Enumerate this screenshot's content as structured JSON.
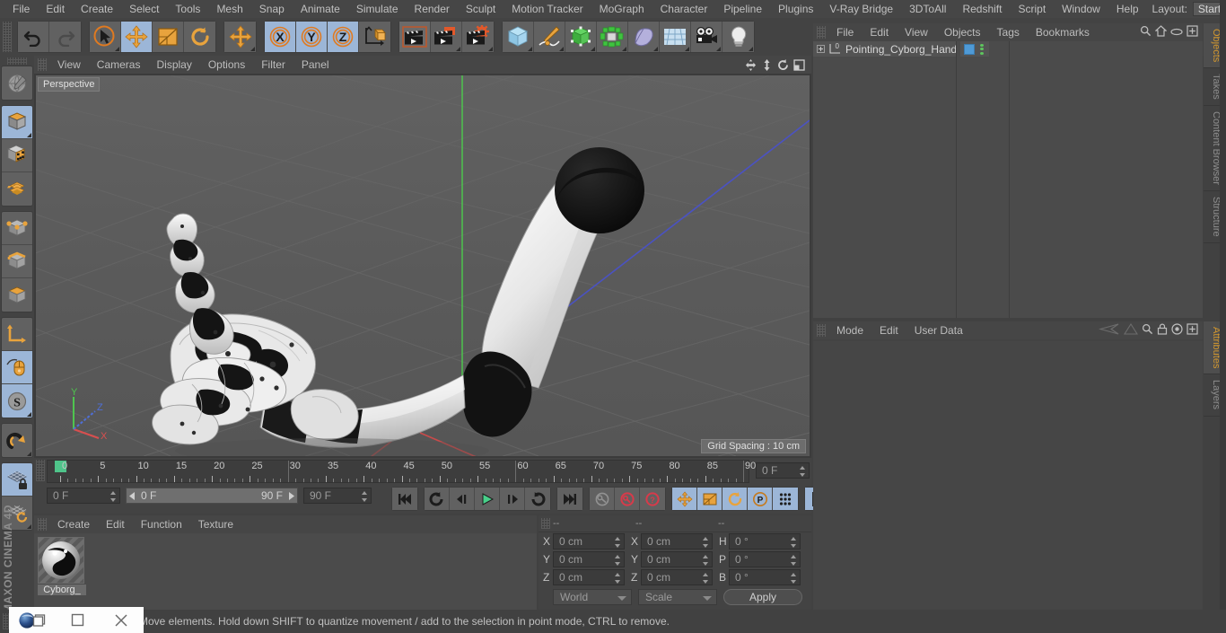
{
  "app": {
    "title": "CINEMA 4D",
    "brand": "MAXON CINEMA 4D"
  },
  "menubar": {
    "items": [
      "File",
      "Edit",
      "Create",
      "Select",
      "Tools",
      "Mesh",
      "Snap",
      "Animate",
      "Simulate",
      "Render",
      "Sculpt",
      "Motion Tracker",
      "MoGraph",
      "Character",
      "Pipeline",
      "Plugins",
      "V-Ray Bridge",
      "3DToAll",
      "Redshift",
      "Script",
      "Window",
      "Help"
    ],
    "layout_label": "Layout:",
    "layout_value": "Startup",
    "search_icon": "magnifier-icon"
  },
  "toolbar": {
    "groups": [
      {
        "name": "history",
        "buttons": [
          {
            "name": "undo-button",
            "icon": "undo-icon",
            "active": false
          },
          {
            "name": "redo-button",
            "icon": "redo-icon",
            "active": false,
            "disabled": true
          }
        ]
      },
      {
        "name": "tools",
        "buttons": [
          {
            "name": "live-selection-button",
            "icon": "live-selection-icon",
            "active": false
          },
          {
            "name": "move-button",
            "icon": "move-icon",
            "active": true
          },
          {
            "name": "scale-button",
            "icon": "scale-icon",
            "active": false
          },
          {
            "name": "rotate-button",
            "icon": "rotate-icon",
            "active": false
          }
        ]
      },
      {
        "name": "move-single",
        "buttons": [
          {
            "name": "move-tool-button",
            "icon": "move-icon",
            "active": false
          }
        ]
      },
      {
        "name": "axis-locks",
        "buttons": [
          {
            "name": "lock-x-button",
            "icon": "x-axis-icon",
            "active": true
          },
          {
            "name": "lock-y-button",
            "icon": "y-axis-icon",
            "active": true
          },
          {
            "name": "lock-z-button",
            "icon": "z-axis-icon",
            "active": true
          },
          {
            "name": "world-object-coordinate-button",
            "icon": "world-coordinate-icon",
            "active": false
          }
        ]
      },
      {
        "name": "render",
        "buttons": [
          {
            "name": "render-view-button",
            "icon": "render-view-icon",
            "active": false
          },
          {
            "name": "render-to-picture-viewer-button",
            "icon": "render-picture-viewer-icon",
            "active": false
          },
          {
            "name": "render-settings-button",
            "icon": "render-settings-icon",
            "active": false
          }
        ]
      },
      {
        "name": "objects",
        "buttons": [
          {
            "name": "add-cube-button",
            "icon": "cube-icon",
            "active": false
          },
          {
            "name": "add-spline-button",
            "icon": "pen-spline-icon",
            "active": false
          },
          {
            "name": "add-generator-button",
            "icon": "generator-icon",
            "active": false
          },
          {
            "name": "add-mograph-button",
            "icon": "mograph-icon",
            "active": false
          },
          {
            "name": "add-deformer-button",
            "icon": "deformer-icon",
            "active": false
          },
          {
            "name": "add-floor-button",
            "icon": "environment-icon",
            "active": false
          },
          {
            "name": "add-camera-button",
            "icon": "camera-icon",
            "active": false
          },
          {
            "name": "add-light-button",
            "icon": "light-bulb-icon",
            "active": false
          }
        ]
      }
    ]
  },
  "left_toolbar": {
    "groups": [
      {
        "buttons": [
          {
            "name": "make-editable-button",
            "icon": "make-editable-icon",
            "active": false
          }
        ]
      },
      {
        "buttons": [
          {
            "name": "model-mode-button",
            "icon": "model-mode-icon",
            "active": true
          },
          {
            "name": "texture-mode-button",
            "icon": "texture-mode-icon",
            "active": false
          },
          {
            "name": "workplane-mode-button",
            "icon": "workplane-icon",
            "active": false
          }
        ]
      },
      {
        "buttons": [
          {
            "name": "points-mode-button",
            "icon": "points-mode-icon",
            "active": false
          },
          {
            "name": "edges-mode-button",
            "icon": "edges-mode-icon",
            "active": false
          },
          {
            "name": "polygons-mode-button",
            "icon": "polygons-mode-icon",
            "active": false
          }
        ]
      },
      {
        "buttons": [
          {
            "name": "axis-mode-button",
            "icon": "axis-mode-icon",
            "active": false
          },
          {
            "name": "enable-axis-button",
            "icon": "mouse-axis-icon",
            "active": true
          },
          {
            "name": "soft-selection-button",
            "icon": "soft-selection-icon",
            "active": true
          }
        ]
      },
      {
        "buttons": [
          {
            "name": "snap-button",
            "icon": "magnet-snap-icon",
            "active": false
          }
        ]
      },
      {
        "buttons": [
          {
            "name": "workplane-lock-button",
            "icon": "workplane-lock-icon",
            "active": true
          },
          {
            "name": "planar-workplane-button",
            "icon": "planar-workplane-icon",
            "active": false
          }
        ]
      }
    ]
  },
  "viewport": {
    "menu_items": [
      "View",
      "Cameras",
      "Display",
      "Options",
      "Filter",
      "Panel"
    ],
    "view_label": "Perspective",
    "grid_info": "Grid Spacing : 10 cm",
    "nav_icons": [
      "pan-view-icon",
      "dolly-view-icon",
      "rotate-view-icon",
      "maximize-view-icon"
    ],
    "axis_labels": {
      "x": "X",
      "y": "Y",
      "z": "Z"
    },
    "axis_colors": {
      "x": "#d84f4f",
      "y": "#4fc44f",
      "z": "#4f6fd8"
    }
  },
  "timeline": {
    "playhead_frame": "0",
    "tick_labels": [
      "0",
      "5",
      "10",
      "15",
      "20",
      "25",
      "30",
      "35",
      "40",
      "45",
      "50",
      "55",
      "60",
      "65",
      "70",
      "75",
      "80",
      "85",
      "90"
    ],
    "current_frame_field": "0 F",
    "current_frame_field2": "0 F",
    "range_start": "0 F",
    "range_end": "90 F",
    "max_frame_field": "90 F",
    "transport": [
      {
        "name": "go-to-start-button",
        "icon": "skip-start-icon"
      },
      {
        "name": "play-backwards-button",
        "icon": "rewind-icon"
      },
      {
        "name": "go-to-previous-frame-button",
        "icon": "step-back-icon"
      },
      {
        "name": "play-forwards-button",
        "icon": "play-icon"
      },
      {
        "name": "go-to-next-frame-button",
        "icon": "step-forward-icon"
      },
      {
        "name": "play-loop-button",
        "icon": "loop-icon"
      },
      {
        "name": "go-to-end-button",
        "icon": "skip-end-icon"
      }
    ],
    "keys": [
      {
        "name": "record-active-objects-button",
        "icon": "key-record-icon"
      },
      {
        "name": "autokeying-button",
        "icon": "autokey-icon"
      },
      {
        "name": "keyframe-selection-button",
        "icon": "keyframe-selection-icon"
      }
    ],
    "toggles": [
      {
        "name": "position-key-button",
        "icon": "move-icon",
        "active": true
      },
      {
        "name": "scale-key-button",
        "icon": "scale-icon",
        "active": true
      },
      {
        "name": "rotation-key-button",
        "icon": "rotate-icon",
        "active": true
      },
      {
        "name": "pla-key-button",
        "icon": "pla-icon",
        "active": true
      },
      {
        "name": "parameter-key-button",
        "icon": "param-dots-icon",
        "active": true
      }
    ],
    "strip": {
      "name": "timeline-strip-button",
      "icon": "film-strip-icon",
      "active": true
    }
  },
  "material_manager": {
    "menu_items": [
      "Create",
      "Edit",
      "Function",
      "Texture"
    ],
    "materials": [
      {
        "name": "Cyborg_",
        "swatch": "black-white-sphere"
      }
    ]
  },
  "coordinates": {
    "headers": [
      "--",
      "--",
      "--"
    ],
    "rows": [
      {
        "label_pos": "X",
        "value_pos": "0 cm",
        "label_size": "X",
        "value_size": "0 cm",
        "label_rot": "H",
        "value_rot": "0 °"
      },
      {
        "label_pos": "Y",
        "value_pos": "0 cm",
        "label_size": "Y",
        "value_size": "0 cm",
        "label_rot": "P",
        "value_rot": "0 °"
      },
      {
        "label_pos": "Z",
        "value_pos": "0 cm",
        "label_size": "Z",
        "value_size": "0 cm",
        "label_rot": "B",
        "value_rot": "0 °"
      }
    ],
    "coord_system": "World",
    "transform_mode": "Scale",
    "apply_label": "Apply"
  },
  "object_manager": {
    "menu_items": [
      "File",
      "Edit",
      "View",
      "Objects",
      "Tags",
      "Bookmarks"
    ],
    "tools": [
      "magnifier-icon",
      "home-icon",
      "ellipse-icon",
      "plus-box-icon"
    ],
    "objects": [
      {
        "name": "Pointing_Cyborg_Hand",
        "layer_badge": "0",
        "tags": [
          "texture-tag",
          "vertexmap-tag"
        ]
      }
    ]
  },
  "attribute_manager": {
    "menu_items": [
      "Mode",
      "Edit",
      "User Data"
    ],
    "tools": [
      "history-back-icon",
      "history-forward-icon",
      "magnifier-icon",
      "lock-icon",
      "target-icon",
      "plus-box-icon"
    ]
  },
  "right_tabs": {
    "top": [
      {
        "label": "Objects",
        "active": true
      },
      {
        "label": "Takes",
        "active": false
      },
      {
        "label": "Content Browser",
        "active": false
      },
      {
        "label": "Structure",
        "active": false
      }
    ],
    "bottom": [
      {
        "label": "Attributes",
        "active": true
      },
      {
        "label": "Layers",
        "active": false
      }
    ]
  },
  "statusbar": {
    "text": "Move elements. Hold down SHIFT to quantize movement / add to the selection in point mode, CTRL to remove."
  },
  "taskbar": {
    "items": [
      {
        "name": "cinema4d-taskbar-icon",
        "icon": "c4d-sphere-icon"
      },
      {
        "name": "restore-window-button",
        "icon": "square-icon"
      },
      {
        "name": "close-window-button",
        "icon": "close-icon"
      }
    ]
  }
}
